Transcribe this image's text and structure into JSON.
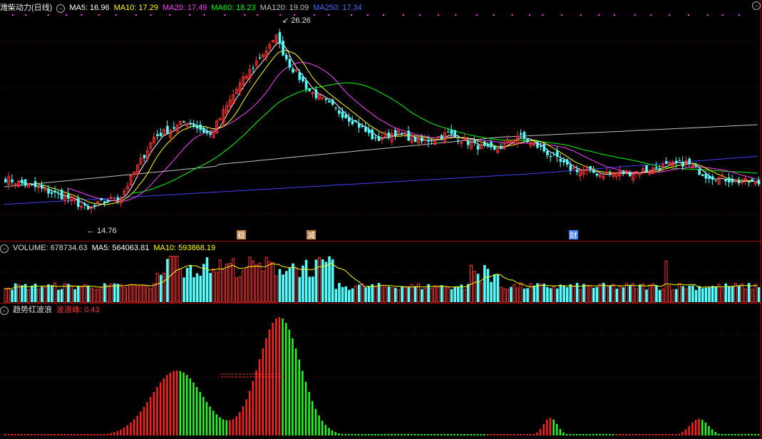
{
  "header": {
    "title": "潍柴动力(日线)",
    "ma5": "MA5: 16.96",
    "ma10": "MA10: 17.29",
    "ma20": "MA20: 17.49",
    "ma60": "MA60: 18.23",
    "ma120": "MA120: 19.09",
    "ma250": "MA250: 17.34",
    "ctrl_icon": "circle-minus-icon"
  },
  "volume_header": {
    "volume": "VOLUME: 678734.63",
    "ma5": "MA5: 564063.81",
    "ma10": "MA10: 593868.19"
  },
  "indicator_header": {
    "name": "趋势红波浪",
    "peak": "波浪峰: 0.43"
  },
  "annotations": {
    "high": "26.26",
    "low": "14.76",
    "marker1": "稳",
    "marker2": "减",
    "marker3": "财"
  },
  "colors": {
    "up": "#ff3232",
    "down": "#54ffff",
    "ma5": "#ffffff",
    "ma10": "#ffff00",
    "ma20": "#ff40ff",
    "ma60": "#00ff00",
    "ma120": "#c0c0c0",
    "ma250": "#4040ff",
    "wave_up": "#ff2020",
    "wave_down": "#20ff20"
  },
  "chart_data": [
    {
      "type": "candlestick",
      "ylim": [
        14,
        27
      ],
      "high_point": 26.26,
      "low_point": 14.76,
      "keypoints": [
        [
          0,
          16.9
        ],
        [
          10,
          16.3
        ],
        [
          20,
          15.6
        ],
        [
          25,
          14.9
        ],
        [
          28,
          15.3
        ],
        [
          35,
          15.8
        ],
        [
          45,
          19.5
        ],
        [
          55,
          20.5
        ],
        [
          62,
          19.6
        ],
        [
          70,
          22.5
        ],
        [
          77,
          24.5
        ],
        [
          82,
          25.6
        ],
        [
          86,
          24.0
        ],
        [
          92,
          22.4
        ],
        [
          100,
          21.2
        ],
        [
          106,
          20.4
        ],
        [
          112,
          19.3
        ],
        [
          118,
          19.8
        ],
        [
          126,
          19.2
        ],
        [
          134,
          19.7
        ],
        [
          142,
          19.0
        ],
        [
          148,
          18.6
        ],
        [
          155,
          19.6
        ],
        [
          162,
          18.8
        ],
        [
          170,
          17.6
        ],
        [
          180,
          17.2
        ],
        [
          190,
          17.3
        ],
        [
          200,
          17.7
        ],
        [
          206,
          17.9
        ],
        [
          212,
          17.1
        ],
        [
          220,
          16.8
        ],
        [
          228,
          16.6
        ]
      ],
      "ma_values": {
        "MA5": 16.96,
        "MA10": 17.29,
        "MA20": 17.49,
        "MA60": 18.23,
        "MA120": 19.09,
        "MA250": 17.34
      }
    },
    {
      "type": "bar",
      "name": "VOLUME",
      "value": 678734.63,
      "ma5": 564063.81,
      "ma10": 593868.19
    },
    {
      "type": "bar",
      "name": "趋势红波浪",
      "peak": 0.43
    }
  ]
}
